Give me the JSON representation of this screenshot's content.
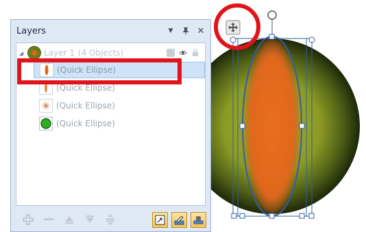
{
  "panel": {
    "title": "Layers",
    "controls": {
      "menu": "▼",
      "pin": "📌",
      "close": "✕"
    }
  },
  "layer": {
    "name": "Layer 1",
    "count": "(4 Objects)"
  },
  "objects": [
    {
      "label": "(Quick Ellipse)",
      "thumb": "orange-ellipse-icon",
      "selected": true
    },
    {
      "label": "(Quick Ellipse)",
      "thumb": "orange-ellipse-icon",
      "selected": false
    },
    {
      "label": "(Quick Ellipse)",
      "thumb": "blur-ellipse-icon",
      "selected": false
    },
    {
      "label": "(Quick Ellipse)",
      "thumb": "green-circle-icon",
      "selected": false
    }
  ],
  "colors": {
    "accent_red": "#e0141b",
    "ellipse_orange": "#e0681e",
    "selection_blue": "#2f5fa8",
    "disk_green": "#6d8419"
  }
}
